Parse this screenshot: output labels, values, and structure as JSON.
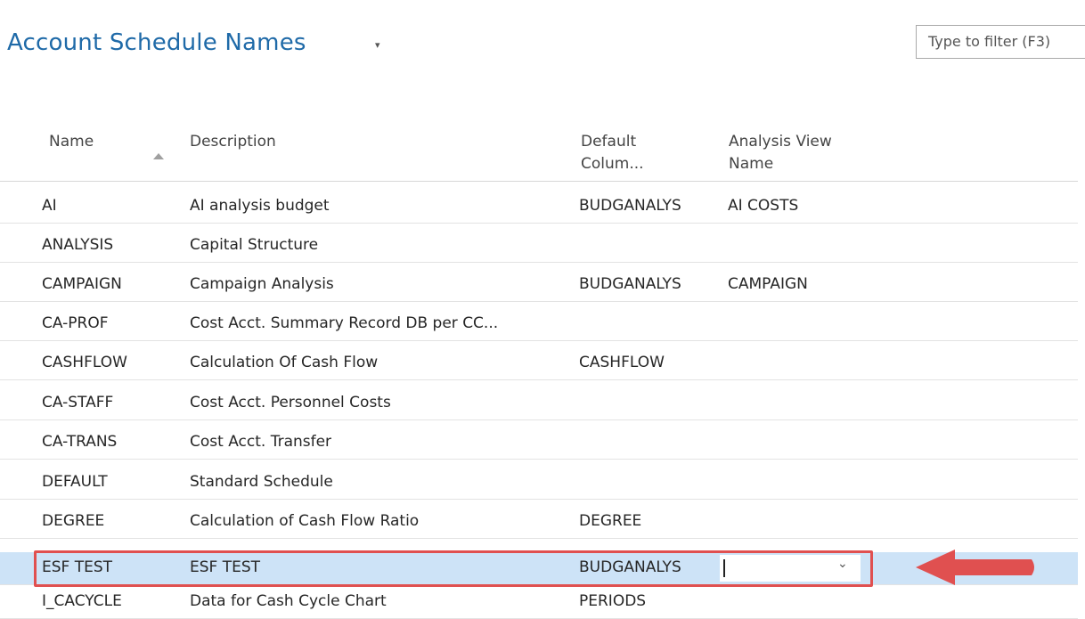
{
  "header": {
    "title": "Account Schedule Names",
    "title_caret": "▾",
    "filter_placeholder": "Type to filter (F3)"
  },
  "columns": {
    "name": "Name",
    "description": "Description",
    "default_column_line1": "Default",
    "default_column_line2": "Colum...",
    "analysis_view_line1": "Analysis View",
    "analysis_view_line2": "Name"
  },
  "rows": [
    {
      "name": "AI",
      "description": "AI analysis budget",
      "default_column": "BUDGANALYS",
      "analysis_view": "AI COSTS"
    },
    {
      "name": "ANALYSIS",
      "description": "Capital Structure",
      "default_column": "",
      "analysis_view": ""
    },
    {
      "name": "CAMPAIGN",
      "description": "Campaign Analysis",
      "default_column": "BUDGANALYS",
      "analysis_view": "CAMPAIGN"
    },
    {
      "name": "CA-PROF",
      "description": "Cost Acct. Summary Record DB per CC...",
      "default_column": "",
      "analysis_view": ""
    },
    {
      "name": "CASHFLOW",
      "description": "Calculation Of Cash Flow",
      "default_column": "CASHFLOW",
      "analysis_view": ""
    },
    {
      "name": "CA-STAFF",
      "description": "Cost Acct. Personnel Costs",
      "default_column": "",
      "analysis_view": ""
    },
    {
      "name": "CA-TRANS",
      "description": "Cost Acct. Transfer",
      "default_column": "",
      "analysis_view": ""
    },
    {
      "name": "DEFAULT",
      "description": "Standard Schedule",
      "default_column": "",
      "analysis_view": ""
    },
    {
      "name": "DEGREE",
      "description": "Calculation of Cash Flow Ratio",
      "default_column": "DEGREE",
      "analysis_view": ""
    },
    {
      "name": "ESF TEST",
      "description": "ESF TEST",
      "default_column": "BUDGANALYS",
      "analysis_view": ""
    },
    {
      "name": "I_CACYCLE",
      "description": "Data for Cash Cycle Chart",
      "default_column": "PERIODS",
      "analysis_view": ""
    }
  ],
  "selected_row_index": 9,
  "colors": {
    "title": "#1f6aa8",
    "selected_row": "#cde3f7",
    "annotation": "#e05050"
  }
}
